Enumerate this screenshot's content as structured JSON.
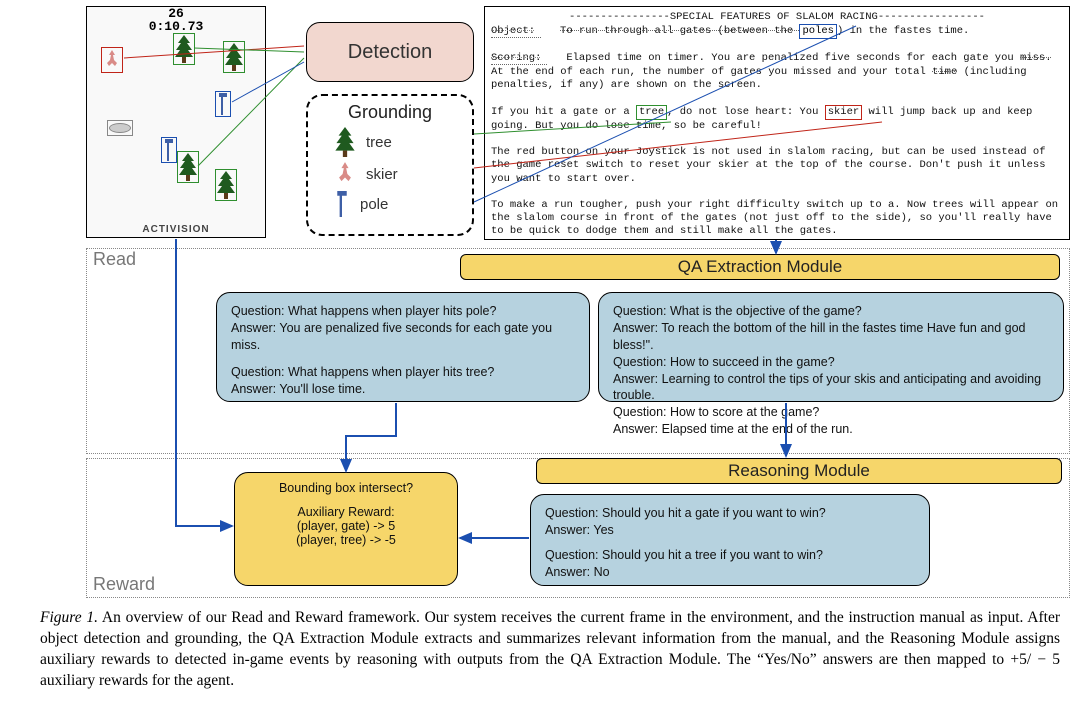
{
  "game": {
    "score_top": "26",
    "timer": "0:10.73",
    "brand": "ACTIVISION"
  },
  "detection": {
    "label": "Detection"
  },
  "grounding": {
    "title": "Grounding",
    "items": [
      {
        "icon": "tree-icon",
        "label": "tree"
      },
      {
        "icon": "skier-icon",
        "label": "skier"
      },
      {
        "icon": "pole-icon",
        "label": "pole"
      }
    ]
  },
  "manual": {
    "header_dashes_left": "----------------",
    "header_title": "SPECIAL FEATURES OF SLALOM RACING",
    "header_dashes_right": "-----------------",
    "object_label": "Object:",
    "object_text_pre": "To run through all gates (between the ",
    "object_word_poles": "poles",
    "object_text_post": ") in the fastes time.",
    "scoring_label": "Scoring:",
    "scoring_line1_a": "Elapsed time on timer.  You are penalized five seconds for each gate you ",
    "scoring_miss": "miss.",
    "scoring_line1_b": "  At the end of each run, the number of gates you missed and your total ",
    "scoring_time": "time",
    "scoring_line1_c": " (including penalties, if any) are shown on the screen.",
    "hit_line_a": "If you hit a gate or a ",
    "word_tree": "tree",
    "hit_line_b": ", do not lose heart:  You ",
    "word_skier": "skier",
    "hit_line_c": " will jump back up and keep going.  But you do lose time, so be careful!",
    "para3": "The red button on your Joystick is not used in slalom racing, but can be used instead of the game reset switch to reset your skier at the top of the course. Don't push it unless you want to start over.",
    "para4": "To make a run tougher, push your right difficulty switch up to a.  Now trees will appear on the slalom course in front of the gates (not just off to the side), so you'll really have to be quick to dodge them and still make all the gates."
  },
  "side_labels": {
    "read": "Read",
    "reward": "Reward"
  },
  "qa_module_header": "QA Extraction Module",
  "reasoning_module_header": "Reasoning Module",
  "qa1": {
    "q1": "Question: What happens when player hits pole?",
    "a1": "Answer: You are penalized five seconds for each gate you miss.",
    "q2": "Question: What happens when player hits tree?",
    "a2": "Answer: You'll lose time."
  },
  "qa2": {
    "q1": "Question: What is the objective of the game?",
    "a1": "Answer: To reach the bottom of the hill in the fastes time Have fun and god bless!\".",
    "q2": "Question: How to succeed in the game?",
    "a2": "Answer: Learning to control the tips of your skis and anticipating and avoiding trouble.",
    "q3": "Question: How to score at the game?",
    "a3": "Answer: Elapsed time at the end of the run."
  },
  "aux": {
    "title": "Bounding box intersect?",
    "sub": "Auxiliary Reward:",
    "r1": "(player, gate)  ->  5",
    "r2": "(player, tree)  -> -5"
  },
  "reason_qa": {
    "q1": "Question: Should you hit a gate if you want to win?",
    "a1": "Answer: Yes",
    "q2": "Question: Should you hit a tree if you want to win?",
    "a2": "Answer: No"
  },
  "caption": {
    "fignum": "Figure 1.",
    "body": " An overview of our Read and Reward framework. Our system receives the current frame in the environment, and the instruction manual as input. After object detection and grounding, the QA Extraction Module extracts and summarizes relevant information from the manual, and the Reasoning Module assigns auxiliary rewards to detected in-game events by reasoning with outputs from the QA Extraction Module. The “Yes/No” answers are then mapped to +5/ − 5 auxiliary rewards for the agent."
  },
  "colors": {
    "bbox_red": "#c02418",
    "bbox_green": "#2f8f2f",
    "bbox_blue": "#1b4fb0",
    "accent_yellow": "#f6d66a",
    "accent_blue": "#b6d2df",
    "accent_peach": "#f2d7cf"
  }
}
